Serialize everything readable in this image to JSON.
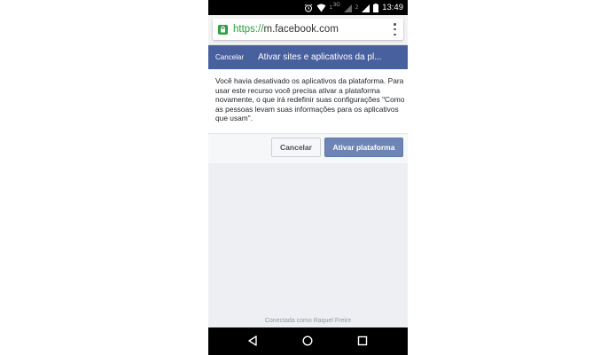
{
  "statusbar": {
    "network_1": "3G",
    "sim_1": "1",
    "sim_2": "2",
    "time": "13:49",
    "icons": [
      "alarm-icon",
      "wifi-icon",
      "signal-icon",
      "battery-icon"
    ]
  },
  "browser": {
    "url_scheme": "https://",
    "url_host": "m.facebook.com",
    "lock_icon": "lock-icon",
    "menu_icon": "more-vert-icon"
  },
  "dialog": {
    "cancel_label": "Cancelar",
    "title": "Ativar sites e aplicativos da pl...",
    "message": "Você havia desativado os aplicativos da plataforma. Para usar este recurso você precisa ativar a plataforma novamente, o que irá redefinir suas configurações \"Como as pessoas levam suas informações para os aplicativos que usam\".",
    "button_cancel": "Cancelar",
    "button_activate": "Ativar plataforma"
  },
  "footer": {
    "text": "Conectada como Raquel Freire"
  },
  "colors": {
    "header_blue": "#48609e",
    "primary_button": "#6d84b4",
    "secure_green": "#2e9e3e"
  }
}
